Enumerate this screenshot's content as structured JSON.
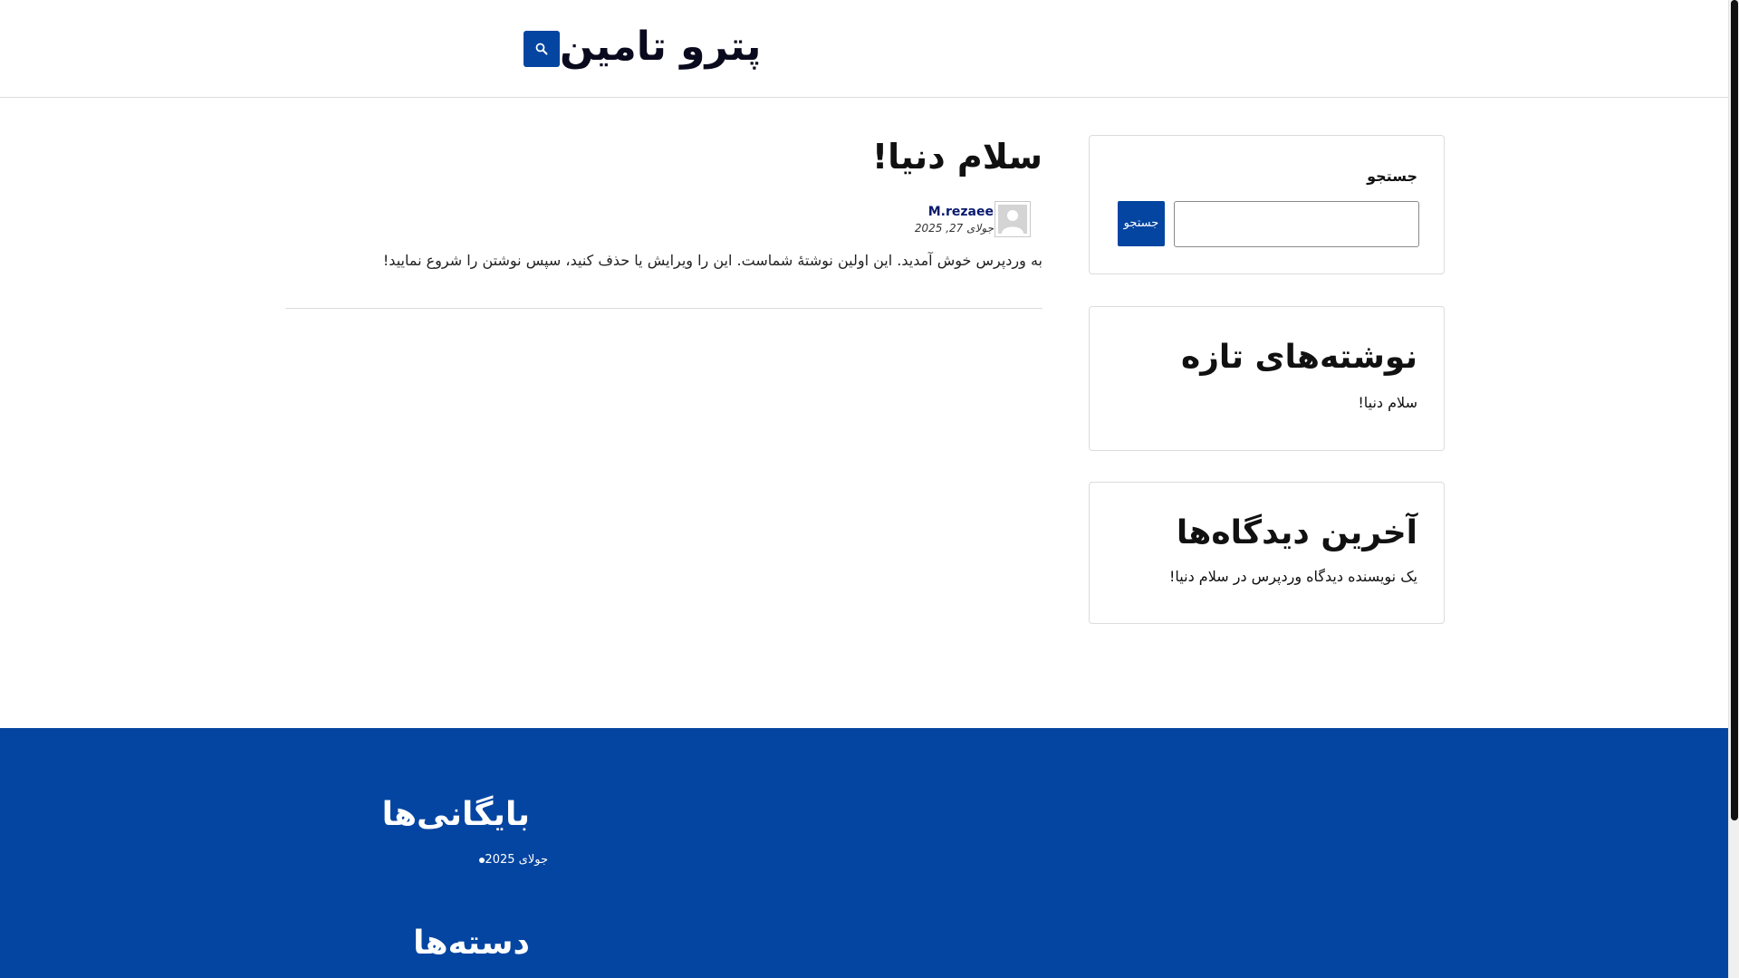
{
  "site": {
    "title": "پترو تامین",
    "search_icon": "search-icon"
  },
  "post": {
    "title": "سلام دنیا!",
    "author": "M.rezaee",
    "date": "جولای 27, 2025",
    "excerpt": "به وردپرس خوش آمدید. این اولین نوشتهٔ شماست. این را ویرایش یا حذف کنید، سپس نوشتن را شروع نمایید!"
  },
  "sidebar": {
    "search": {
      "label": "جستجو",
      "input_value": "",
      "button_label": "جستجو"
    },
    "recent_posts": {
      "heading": "نوشته‌های تازه",
      "items": [
        "سلام دنیا!"
      ]
    },
    "recent_comments": {
      "heading": "آخرین دیدگاه‌ها",
      "items": [
        "یک نویسنده دیدگاه وردپرس در سلام دنیا!"
      ]
    }
  },
  "footer": {
    "archives": {
      "heading": "بایگانی‌ها",
      "items": [
        "جولای 2025"
      ]
    },
    "categories": {
      "heading": "دسته‌ها"
    }
  },
  "colors": {
    "brand_blue": "#0445a1",
    "author_link": "#0a1a6e"
  }
}
